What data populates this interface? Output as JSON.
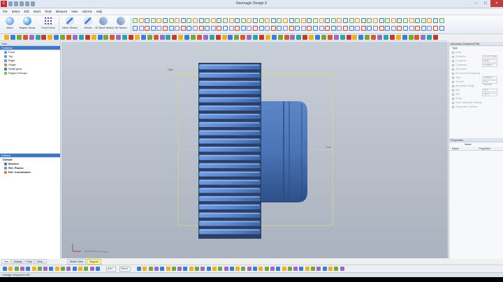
{
  "window": {
    "title": "Geomagic Design X"
  },
  "menu": [
    "File",
    "Select",
    "Edit",
    "Insert",
    "Tools",
    "Measure",
    "View",
    "Add-Ins",
    "Help"
  ],
  "ribbon": {
    "buttons": [
      {
        "label": "Mesh",
        "icon": "mesh-icon"
      },
      {
        "label": "Region Group",
        "icon": "region-group-icon"
      },
      {
        "label": "Point Cloud",
        "icon": "point-cloud-icon"
      },
      {
        "label": "Mesh Sketch",
        "icon": "mesh-sketch-icon"
      },
      {
        "label": "Sketch",
        "icon": "sketch-icon"
      },
      {
        "label": "3D Mesh Sketch",
        "icon": "3d-mesh-sketch-icon"
      },
      {
        "label": "3D Sketch",
        "icon": "3d-sketch-icon"
      }
    ]
  },
  "tree_panel": {
    "title": "Tree",
    "group": "Features",
    "items": [
      "Front",
      "Top",
      "Right",
      "Origin",
      "Small gear",
      "Region Group1"
    ]
  },
  "display_panel": {
    "title": "Default",
    "items": [
      "Default",
      "Meshes",
      "Ref. Planes",
      "Ref. Coordinates"
    ]
  },
  "left_tabs": [
    "Tree",
    "Display",
    "Help",
    "View..."
  ],
  "viewport": {
    "labels": {
      "plane_right": "Right",
      "plane_front": "Front"
    },
    "scale_label": "25 mm",
    "tabs": [
      "Model View",
      "Support"
    ]
  },
  "accuracy_panel": {
    "title": "Accuracy Analyzer(TM)",
    "type_label": "Type",
    "rows": [
      {
        "label": "None",
        "value": ""
      },
      {
        "label": "Deviation",
        "value": "Curve Plane"
      },
      {
        "label": "Curvature",
        "value": "Mean"
      },
      {
        "label": "Continuity",
        "value": "Position"
      },
      {
        "label": "Thickness",
        "value": ""
      },
      {
        "label": "Environment Mapping",
        "value": ""
      },
      {
        "label": "Type",
        "value": "Systems"
      },
      {
        "label": "Texture",
        "value": "Fine Spheres"
      },
      {
        "label": "Allowable Range",
        "value": ""
      },
      {
        "label": "Max",
        "value": "45.0"
      },
      {
        "label": "Min",
        "value": "-45.0"
      },
      {
        "label": "Scale",
        "value": ""
      },
      {
        "label": "Color Allowable Ratings",
        "value": ""
      },
      {
        "label": "Regression Options",
        "value": ""
      }
    ]
  },
  "properties_panel": {
    "title": "Properties",
    "filter": "Name",
    "columns": [
      "Name",
      "Properties"
    ]
  },
  "bottom_toolbar": {
    "select_mode": "Auto",
    "filter": "Select"
  },
  "status": {
    "text": "Change Viewport to left"
  },
  "colors": {
    "accent": "#3f79c6",
    "gear": "#4a78b8",
    "viewport_bg": "#c2c8d2",
    "bounds": "#d6dc8a"
  }
}
